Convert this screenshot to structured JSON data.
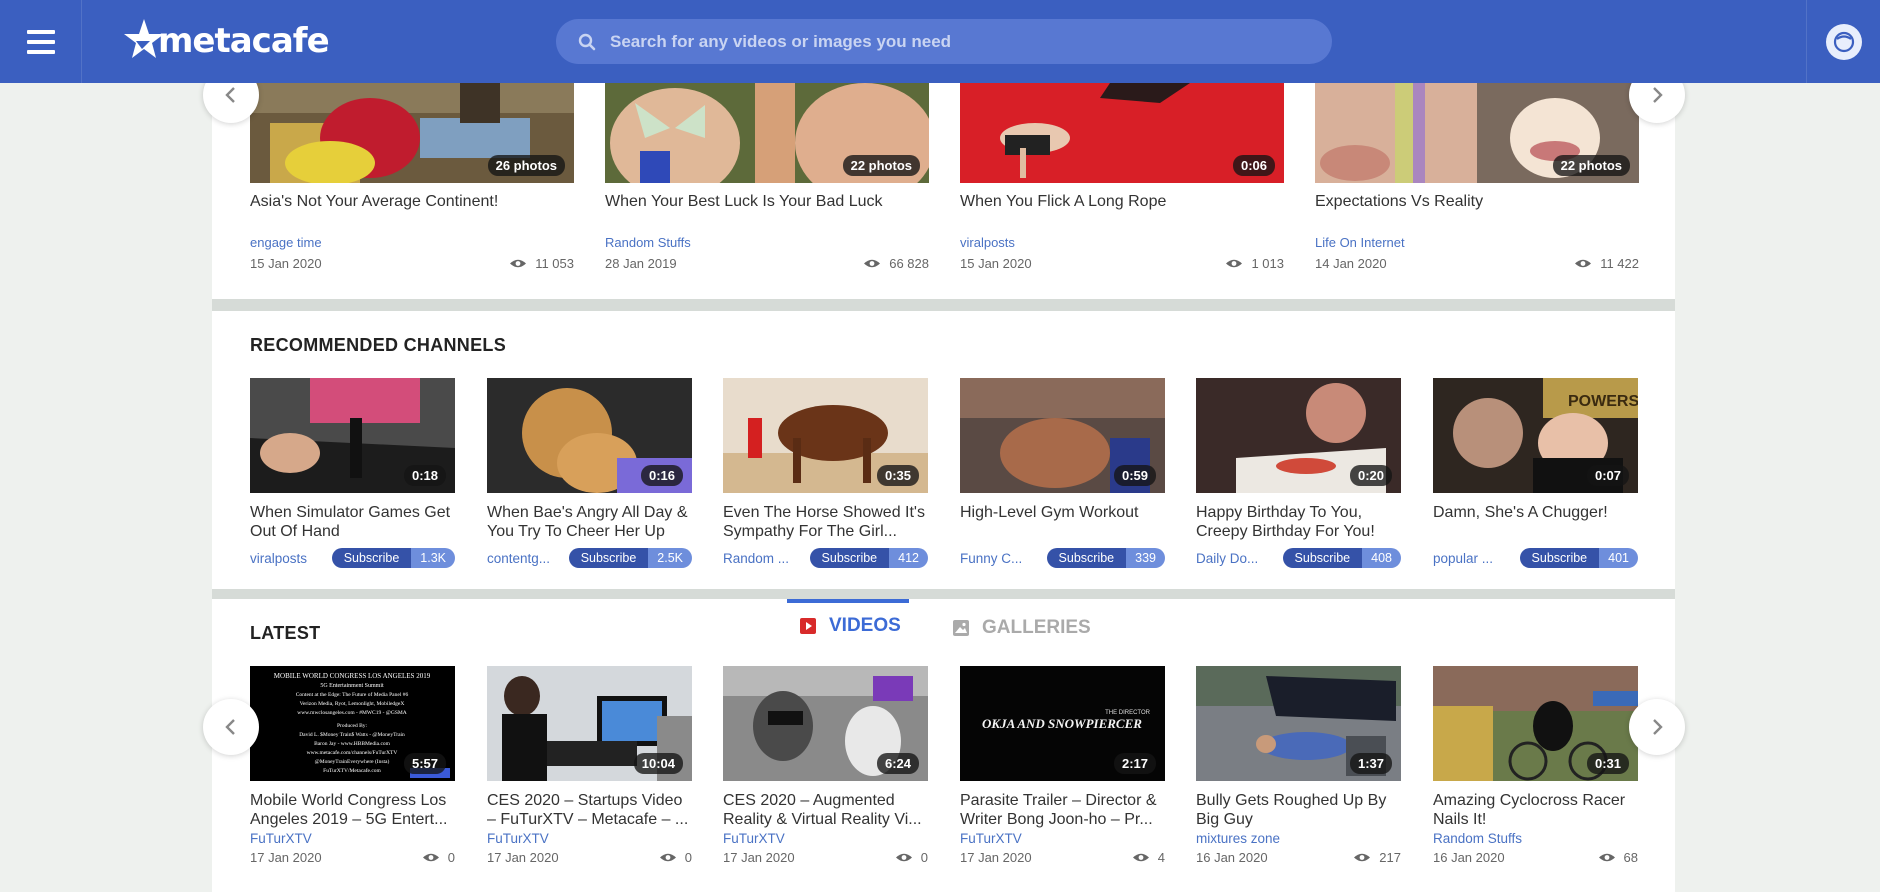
{
  "header": {
    "logo_text": "metacafe",
    "search_placeholder": "Search for any videos or images you need"
  },
  "top_cards": [
    {
      "title": "Asia's Not Your Average Continent!",
      "badge": "26 photos",
      "channel": "engage time",
      "date": "15 Jan 2020",
      "views": "11 053"
    },
    {
      "title": "When Your Best Luck Is Your Bad Luck",
      "badge": "22 photos",
      "channel": "Random Stuffs",
      "date": "28 Jan 2019",
      "views": "66 828"
    },
    {
      "title": "When You Flick A Long Rope",
      "badge": "0:06",
      "channel": "viralposts",
      "date": "15 Jan 2020",
      "views": "1 013"
    },
    {
      "title": "Expectations Vs Reality",
      "badge": "22 photos",
      "channel": "Life On Internet",
      "date": "14 Jan 2020",
      "views": "11 422"
    }
  ],
  "recommended": {
    "title": "RECOMMENDED CHANNELS",
    "subscribe_label": "Subscribe",
    "items": [
      {
        "title": "When Simulator Games Get Out Of Hand",
        "duration": "0:18",
        "channel": "viralposts",
        "subs": "1.3K"
      },
      {
        "title": "When Bae's Angry All Day & You Try To Cheer Her Up",
        "duration": "0:16",
        "channel": "contentg...",
        "subs": "2.5K"
      },
      {
        "title": "Even The Horse Showed It's Sympathy For The Girl...",
        "duration": "0:35",
        "channel": "Random ...",
        "subs": "412"
      },
      {
        "title": "High-Level Gym Workout",
        "duration": "0:59",
        "channel": "Funny C...",
        "subs": "339"
      },
      {
        "title": "Happy Birthday To You, Creepy Birthday For You!",
        "duration": "0:20",
        "channel": "Daily Do...",
        "subs": "408"
      },
      {
        "title": "Damn, She's A Chugger!",
        "duration": "0:07",
        "channel": "popular ...",
        "subs": "401"
      }
    ]
  },
  "latest": {
    "title": "LATEST",
    "tabs": {
      "videos": "VIDEOS",
      "galleries": "GALLERIES"
    },
    "items": [
      {
        "title": "Mobile World Congress Los Angeles 2019 – 5G Entert...",
        "duration": "5:57",
        "channel": "FuTurXTV",
        "date": "17 Jan 2020",
        "views": "0"
      },
      {
        "title": "CES 2020 – Startups Video – FuTurXTV – Metacafe – ...",
        "duration": "10:04",
        "channel": "FuTurXTV",
        "date": "17 Jan 2020",
        "views": "0"
      },
      {
        "title": "CES 2020 – Augmented Reality & Virtual Reality Vi...",
        "duration": "6:24",
        "channel": "FuTurXTV",
        "date": "17 Jan 2020",
        "views": "0"
      },
      {
        "title": "Parasite Trailer – Director & Writer Bong Joon-ho – Pr...",
        "duration": "2:17",
        "channel": "FuTurXTV",
        "date": "17 Jan 2020",
        "views": "4"
      },
      {
        "title": "Bully Gets Roughed Up By Big Guy",
        "duration": "1:37",
        "channel": "mixtures zone",
        "date": "16 Jan 2020",
        "views": "217"
      },
      {
        "title": "Amazing Cyclocross Racer Nails It!",
        "duration": "0:31",
        "channel": "Random Stuffs",
        "date": "16 Jan 2020",
        "views": "68"
      }
    ]
  },
  "thumb_text": {
    "mwc": [
      "MOBILE WORLD CONGRESS LOS ANGELES 2019",
      "5G Entertainment Summit",
      "Content at the Edge: The Future of Media Panel #6",
      "Verizon Media, Ryot, Lemonlight, MobiledgeX",
      "www.mwclosangeles.com - #MWC19 - @GSMA",
      "Produced By:",
      "David L. $Money Train$ Watts - @MoneyTrain",
      "Baron Jay - www.HBBMedia.com",
      "www.metacafe.com/channels/FuTurXTV",
      "@MoneyTrainEverywhere (Insta)",
      "FuTurXTV/Metacafe.com"
    ],
    "parasite_director": "THE DIRECTOR",
    "parasite_films": "OKJA AND SNOWPIERCER",
    "powers": "POWERS"
  }
}
